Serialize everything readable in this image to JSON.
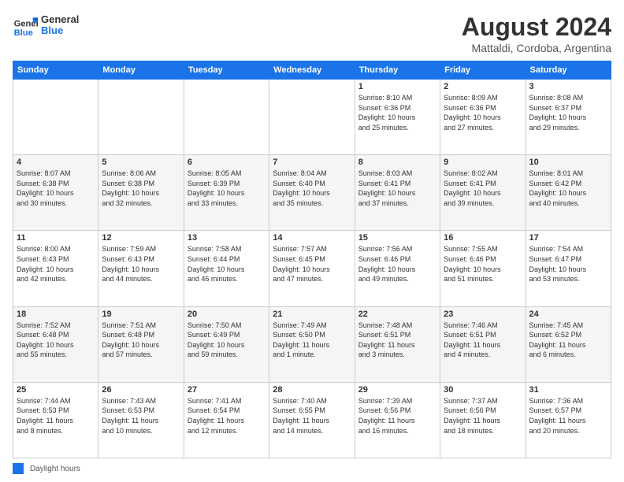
{
  "header": {
    "logo_general": "General",
    "logo_blue": "Blue",
    "month_title": "August 2024",
    "location": "Mattaldi, Cordoba, Argentina"
  },
  "days_of_week": [
    "Sunday",
    "Monday",
    "Tuesday",
    "Wednesday",
    "Thursday",
    "Friday",
    "Saturday"
  ],
  "weeks": [
    [
      {
        "day": "",
        "info": ""
      },
      {
        "day": "",
        "info": ""
      },
      {
        "day": "",
        "info": ""
      },
      {
        "day": "",
        "info": ""
      },
      {
        "day": "1",
        "info": "Sunrise: 8:10 AM\nSunset: 6:36 PM\nDaylight: 10 hours\nand 25 minutes."
      },
      {
        "day": "2",
        "info": "Sunrise: 8:09 AM\nSunset: 6:36 PM\nDaylight: 10 hours\nand 27 minutes."
      },
      {
        "day": "3",
        "info": "Sunrise: 8:08 AM\nSunset: 6:37 PM\nDaylight: 10 hours\nand 29 minutes."
      }
    ],
    [
      {
        "day": "4",
        "info": "Sunrise: 8:07 AM\nSunset: 6:38 PM\nDaylight: 10 hours\nand 30 minutes."
      },
      {
        "day": "5",
        "info": "Sunrise: 8:06 AM\nSunset: 6:38 PM\nDaylight: 10 hours\nand 32 minutes."
      },
      {
        "day": "6",
        "info": "Sunrise: 8:05 AM\nSunset: 6:39 PM\nDaylight: 10 hours\nand 33 minutes."
      },
      {
        "day": "7",
        "info": "Sunrise: 8:04 AM\nSunset: 6:40 PM\nDaylight: 10 hours\nand 35 minutes."
      },
      {
        "day": "8",
        "info": "Sunrise: 8:03 AM\nSunset: 6:41 PM\nDaylight: 10 hours\nand 37 minutes."
      },
      {
        "day": "9",
        "info": "Sunrise: 8:02 AM\nSunset: 6:41 PM\nDaylight: 10 hours\nand 39 minutes."
      },
      {
        "day": "10",
        "info": "Sunrise: 8:01 AM\nSunset: 6:42 PM\nDaylight: 10 hours\nand 40 minutes."
      }
    ],
    [
      {
        "day": "11",
        "info": "Sunrise: 8:00 AM\nSunset: 6:43 PM\nDaylight: 10 hours\nand 42 minutes."
      },
      {
        "day": "12",
        "info": "Sunrise: 7:59 AM\nSunset: 6:43 PM\nDaylight: 10 hours\nand 44 minutes."
      },
      {
        "day": "13",
        "info": "Sunrise: 7:58 AM\nSunset: 6:44 PM\nDaylight: 10 hours\nand 46 minutes."
      },
      {
        "day": "14",
        "info": "Sunrise: 7:57 AM\nSunset: 6:45 PM\nDaylight: 10 hours\nand 47 minutes."
      },
      {
        "day": "15",
        "info": "Sunrise: 7:56 AM\nSunset: 6:46 PM\nDaylight: 10 hours\nand 49 minutes."
      },
      {
        "day": "16",
        "info": "Sunrise: 7:55 AM\nSunset: 6:46 PM\nDaylight: 10 hours\nand 51 minutes."
      },
      {
        "day": "17",
        "info": "Sunrise: 7:54 AM\nSunset: 6:47 PM\nDaylight: 10 hours\nand 53 minutes."
      }
    ],
    [
      {
        "day": "18",
        "info": "Sunrise: 7:52 AM\nSunset: 6:48 PM\nDaylight: 10 hours\nand 55 minutes."
      },
      {
        "day": "19",
        "info": "Sunrise: 7:51 AM\nSunset: 6:48 PM\nDaylight: 10 hours\nand 57 minutes."
      },
      {
        "day": "20",
        "info": "Sunrise: 7:50 AM\nSunset: 6:49 PM\nDaylight: 10 hours\nand 59 minutes."
      },
      {
        "day": "21",
        "info": "Sunrise: 7:49 AM\nSunset: 6:50 PM\nDaylight: 11 hours\nand 1 minute."
      },
      {
        "day": "22",
        "info": "Sunrise: 7:48 AM\nSunset: 6:51 PM\nDaylight: 11 hours\nand 3 minutes."
      },
      {
        "day": "23",
        "info": "Sunrise: 7:46 AM\nSunset: 6:51 PM\nDaylight: 11 hours\nand 4 minutes."
      },
      {
        "day": "24",
        "info": "Sunrise: 7:45 AM\nSunset: 6:52 PM\nDaylight: 11 hours\nand 6 minutes."
      }
    ],
    [
      {
        "day": "25",
        "info": "Sunrise: 7:44 AM\nSunset: 6:53 PM\nDaylight: 11 hours\nand 8 minutes."
      },
      {
        "day": "26",
        "info": "Sunrise: 7:43 AM\nSunset: 6:53 PM\nDaylight: 11 hours\nand 10 minutes."
      },
      {
        "day": "27",
        "info": "Sunrise: 7:41 AM\nSunset: 6:54 PM\nDaylight: 11 hours\nand 12 minutes."
      },
      {
        "day": "28",
        "info": "Sunrise: 7:40 AM\nSunset: 6:55 PM\nDaylight: 11 hours\nand 14 minutes."
      },
      {
        "day": "29",
        "info": "Sunrise: 7:39 AM\nSunset: 6:56 PM\nDaylight: 11 hours\nand 16 minutes."
      },
      {
        "day": "30",
        "info": "Sunrise: 7:37 AM\nSunset: 6:56 PM\nDaylight: 11 hours\nand 18 minutes."
      },
      {
        "day": "31",
        "info": "Sunrise: 7:36 AM\nSunset: 6:57 PM\nDaylight: 11 hours\nand 20 minutes."
      }
    ]
  ],
  "footer": {
    "legend_label": "Daylight hours"
  }
}
